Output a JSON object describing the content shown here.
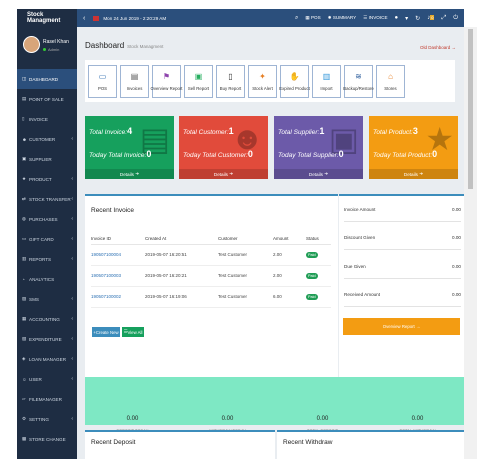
{
  "app": {
    "title": "Stock Managment"
  },
  "topnav": {
    "date": "Mon 24 Jun 2019 - 2:20:29 AM",
    "pos_label": "POS",
    "summary_label": "SUMMARY",
    "invoice_label": "INVOICE",
    "notif_count": "0",
    "accent_color": "#2b4f7c"
  },
  "profile": {
    "name": "Rasel Khan",
    "role": "Admin"
  },
  "sidebar": {
    "items": [
      {
        "label": "DASHBOARD"
      },
      {
        "label": "POINT OF SALE"
      },
      {
        "label": "INVOICE"
      },
      {
        "label": "CUSTOMER"
      },
      {
        "label": "SUPPLIER"
      },
      {
        "label": "PRODUCT"
      },
      {
        "label": "STOCK TRANSFER"
      },
      {
        "label": "PURCHASES"
      },
      {
        "label": "GIFT CARD"
      },
      {
        "label": "REPORTS"
      },
      {
        "label": "ANALYTICS"
      },
      {
        "label": "SMS"
      },
      {
        "label": "ACCOUNTING"
      },
      {
        "label": "EXPENDITURE"
      },
      {
        "label": "LOAN MANAGER"
      },
      {
        "label": "USER"
      },
      {
        "label": "FILEMANAGER"
      },
      {
        "label": "SETTING"
      },
      {
        "label": "STORE CHANGE"
      }
    ]
  },
  "page": {
    "title": "Dashboard",
    "subtitle": "Stock Managment",
    "crumb": "Old Dashboard →"
  },
  "quick": [
    {
      "label": "POS"
    },
    {
      "label": "Invoices"
    },
    {
      "label": "Overview Report"
    },
    {
      "label": "Sell Report"
    },
    {
      "label": "Buy Report"
    },
    {
      "label": "Stock Alert"
    },
    {
      "label": "Expired Product"
    },
    {
      "label": "Import"
    },
    {
      "label": "Backup/Restore"
    },
    {
      "label": "Stores"
    }
  ],
  "cards": [
    {
      "label1": "Total Invoice:",
      "value1": "4",
      "label2": "Today Total Invoice:",
      "value2": "0",
      "details": "Details",
      "color": "#16a05d"
    },
    {
      "label1": "Total Customer:",
      "value1": "1",
      "label2": "Today Total Customer:",
      "value2": "0",
      "details": "Details",
      "color": "#e14b3b"
    },
    {
      "label1": "Total Supplier:",
      "value1": "1",
      "label2": "Today Total Supplier:",
      "value2": "0",
      "details": "Details",
      "color": "#6c5aa9"
    },
    {
      "label1": "Total Product:",
      "value1": "3",
      "label2": "Today Total Product:",
      "value2": "0",
      "details": "Details",
      "color": "#f39c12"
    }
  ],
  "recent_invoice": {
    "title": "Recent Invoice",
    "columns": [
      "Invoice ID",
      "Created At",
      "Customer",
      "Amount",
      "Status"
    ],
    "rows": [
      {
        "id": "190507100004",
        "created": "2019-05-07 16:20:51",
        "customer": "Test Customer",
        "amount": "2.00",
        "status": "Paid"
      },
      {
        "id": "190507100003",
        "created": "2019-05-07 16:20:21",
        "customer": "Test Customer",
        "amount": "2.00",
        "status": "Paid"
      },
      {
        "id": "190507100002",
        "created": "2019-05-07 16:19:06",
        "customer": "Test Customer",
        "amount": "6.00",
        "status": "Paid"
      }
    ],
    "create_label": "Create New",
    "view_label": "View All"
  },
  "summary": {
    "rows": [
      {
        "label": "Invoice Amount",
        "value": "0.00"
      },
      {
        "label": "Discount Given",
        "value": "0.00"
      },
      {
        "label": "Due Given",
        "value": "0.00"
      },
      {
        "label": "Received Amount",
        "value": "0.00"
      }
    ],
    "button": "Overview Report →"
  },
  "deposits": [
    {
      "value": "0.00",
      "label": "Deposit Today"
    },
    {
      "value": "0.00",
      "label": "Withdraw Today"
    },
    {
      "value": "0.00",
      "label": "Total Deposit"
    },
    {
      "value": "0.00",
      "label": "Total Withdraw"
    }
  ],
  "recent_deposit": {
    "title": "Recent Deposit"
  },
  "recent_withdraw": {
    "title": "Recent Withdraw"
  }
}
